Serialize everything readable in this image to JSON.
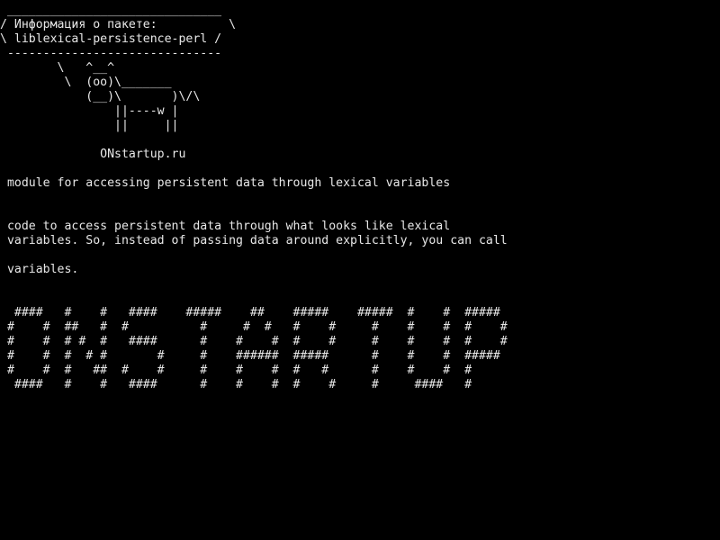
{
  "screen": {
    "background": "#000000",
    "text_color": "#e8e8e8"
  },
  "cowsay": {
    "bubble_top": " ______________________________",
    "bubble_line1": "/ Информация о пакете:          \\",
    "bubble_line2": "\\ liblexical-persistence-perl /",
    "bubble_bottom": " ------------------------------",
    "cow_line1": "        \\   ^__^",
    "cow_line2": "         \\  (oo)\\_______",
    "cow_line3": "            (__)\\       )\\/\\",
    "cow_line4": "                ||----w |",
    "cow_line5": "                ||     ||",
    "site": "              ONstartup.ru"
  },
  "description": {
    "summary": " module for accessing persistent data through lexical variables",
    "details_line1": " code to access persistent data through what looks like lexical",
    "details_line2": " variables. So, instead of passing data around explicitly, you can call",
    "details_line3": " variables."
  },
  "banner": {
    "row1": "  ####   #    #   ####    #####    ##    #####    #####  #    #  #####",
    "row2": " #    #  ##   #  #          #     #  #   #    #     #    #    #  #    #",
    "row3": " #    #  # #  #   ####      #    #    #  #    #     #    #    #  #    #",
    "row4": " #    #  #  # #       #     #    ######  #####      #    #    #  #####",
    "row5": " #    #  #   ##  #    #     #    #    #  #   #      #    #    #  #",
    "row6": "  ####   #    #   ####      #    #    #  #    #     #     ####   #"
  }
}
